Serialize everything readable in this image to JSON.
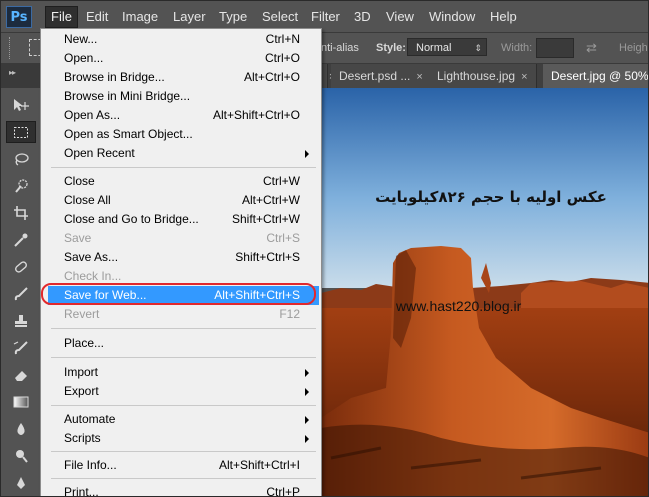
{
  "app": {
    "logo": "Ps"
  },
  "menubar": {
    "items": [
      {
        "label": "File",
        "active": true
      },
      {
        "label": "Edit"
      },
      {
        "label": "Image"
      },
      {
        "label": "Layer"
      },
      {
        "label": "Type"
      },
      {
        "label": "Select"
      },
      {
        "label": "Filter"
      },
      {
        "label": "3D"
      },
      {
        "label": "View"
      },
      {
        "label": "Window"
      },
      {
        "label": "Help"
      }
    ]
  },
  "options_bar": {
    "antialias_label": "nti-alias",
    "style_label": "Style:",
    "style_value": "Normal",
    "width_label": "Width:",
    "height_label": "Heigh"
  },
  "tabs": [
    {
      "label": "Desert.psd ...",
      "close": "×"
    },
    {
      "label": "Lighthouse.jpg",
      "close": "×"
    },
    {
      "label": "Desert.jpg @ 50% (",
      "close": "",
      "active": true
    }
  ],
  "file_menu": {
    "items": [
      {
        "label": "New...",
        "shortcut": "Ctrl+N"
      },
      {
        "label": "Open...",
        "shortcut": "Ctrl+O"
      },
      {
        "label": "Browse in Bridge...",
        "shortcut": "Alt+Ctrl+O"
      },
      {
        "label": "Browse in Mini Bridge...",
        "shortcut": ""
      },
      {
        "label": "Open As...",
        "shortcut": "Alt+Shift+Ctrl+O"
      },
      {
        "label": "Open as Smart Object...",
        "shortcut": ""
      },
      {
        "label": "Open Recent",
        "shortcut": "",
        "submenu": true
      },
      {
        "label": "Close",
        "shortcut": "Ctrl+W"
      },
      {
        "label": "Close All",
        "shortcut": "Alt+Ctrl+W"
      },
      {
        "label": "Close and Go to Bridge...",
        "shortcut": "Shift+Ctrl+W"
      },
      {
        "label": "Save",
        "shortcut": "Ctrl+S",
        "disabled": true
      },
      {
        "label": "Save As...",
        "shortcut": "Shift+Ctrl+S"
      },
      {
        "label": "Check In...",
        "shortcut": "",
        "disabled": true
      },
      {
        "label": "Save for Web...",
        "shortcut": "Alt+Shift+Ctrl+S",
        "highlighted": true
      },
      {
        "label": "Revert",
        "shortcut": "F12",
        "disabled": true
      },
      {
        "label": "Place...",
        "shortcut": ""
      },
      {
        "label": "Import",
        "shortcut": "",
        "submenu": true
      },
      {
        "label": "Export",
        "shortcut": "",
        "submenu": true
      },
      {
        "label": "Automate",
        "shortcut": "",
        "submenu": true
      },
      {
        "label": "Scripts",
        "shortcut": "",
        "submenu": true
      },
      {
        "label": "File Info...",
        "shortcut": "Alt+Shift+Ctrl+I"
      },
      {
        "label": "Print...",
        "shortcut": "Ctrl+P"
      }
    ]
  },
  "canvas": {
    "caption": "عکس اولیه با حجم ۸۲۶کیلوبایت",
    "watermark": "www.hast220.blog.ir"
  },
  "colors": {
    "ui_dark": "#535353",
    "menu_bg": "#f0f0f0",
    "highlight": "#3399ff",
    "ring": "#e2282c"
  }
}
